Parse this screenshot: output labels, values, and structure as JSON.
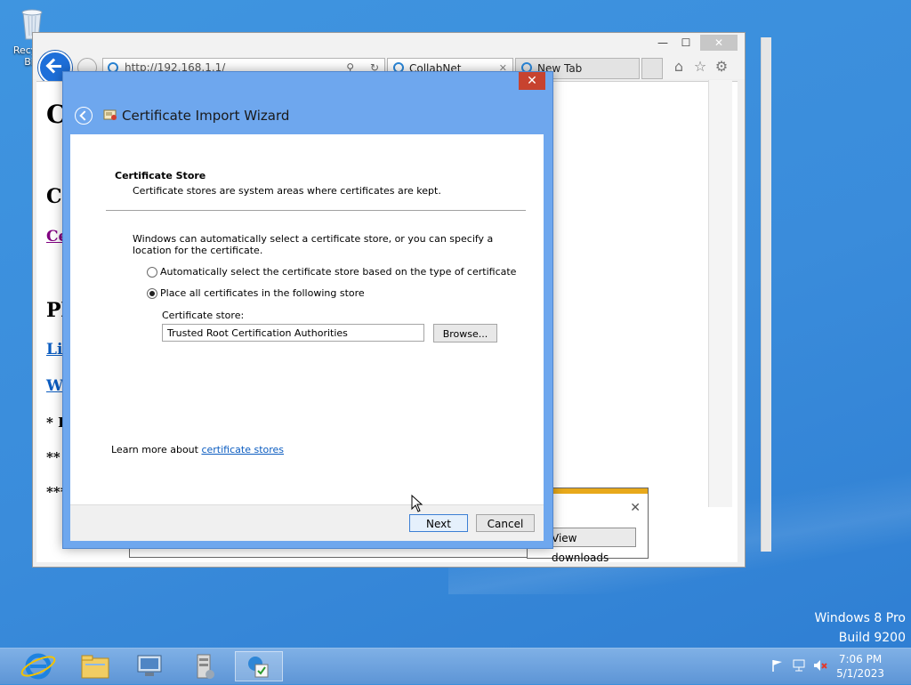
{
  "desktop": {
    "recycle_bin_label": "Recycle Bin",
    "watermark_line1": "Windows 8 Pro",
    "watermark_line2": "Build 9200"
  },
  "browser": {
    "address": "http://192.168.1.1/",
    "tabs": [
      {
        "label": "CollabNet",
        "active": true
      },
      {
        "label": "New Tab",
        "active": false
      }
    ],
    "page_fragments": [
      "C",
      "Ce",
      "Ce",
      "Pl",
      "Li",
      "W",
      "* F",
      "**",
      "***"
    ],
    "download_button": "View downloads"
  },
  "dialog": {
    "title": "Certificate Import Wizard",
    "section_title": "Certificate Store",
    "section_desc": "Certificate stores are system areas where certificates are kept.",
    "intro": "Windows can automatically select a certificate store, or you can specify a location for the certificate.",
    "options": [
      {
        "label": "Automatically select the certificate store based on the type of certificate",
        "selected": false
      },
      {
        "label": "Place all certificates in the following store",
        "selected": true
      }
    ],
    "store_label": "Certificate store:",
    "store_value": "Trusted Root Certification Authorities",
    "browse": "Browse...",
    "learn_prefix": "Learn more about ",
    "learn_link": "certificate stores",
    "next": "Next",
    "cancel": "Cancel",
    "close": "✕"
  },
  "taskbar": {
    "time": "7:06 PM",
    "date": "5/1/2023"
  },
  "colors": {
    "desktop": "#3c8fdc",
    "dialog_frame": "#6ea7ee",
    "close_button": "#c7432f",
    "link": "#0b5cc0",
    "download_stripe": "#e8a91b"
  }
}
